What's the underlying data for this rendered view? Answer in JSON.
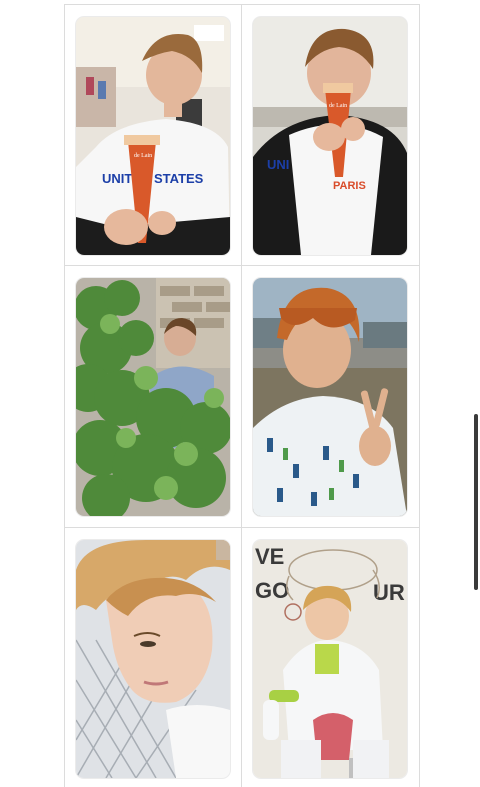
{
  "cards": [
    {
      "id": "card-1",
      "shirt_text": "UNITED STATES",
      "cone_text": "de Lain"
    },
    {
      "id": "card-2",
      "shirt_text": "UNI",
      "shirt_text2": "PARIS",
      "cone_text": "de Lain"
    },
    {
      "id": "card-3"
    },
    {
      "id": "card-4"
    },
    {
      "id": "card-5"
    },
    {
      "id": "card-6",
      "wall_text_left_1": "VE",
      "wall_text_left_2": "GO",
      "wall_text_right": "UR"
    }
  ],
  "colors": {
    "page_bg": "#ffffff",
    "divider": "#dcdcdc",
    "scrollbar": "#3a3a3a",
    "shirt_blue": "#1c3fa8",
    "cone_orange": "#d9592a"
  },
  "icons": {
    "scrollbar": "vertical-scroll-indicator"
  }
}
